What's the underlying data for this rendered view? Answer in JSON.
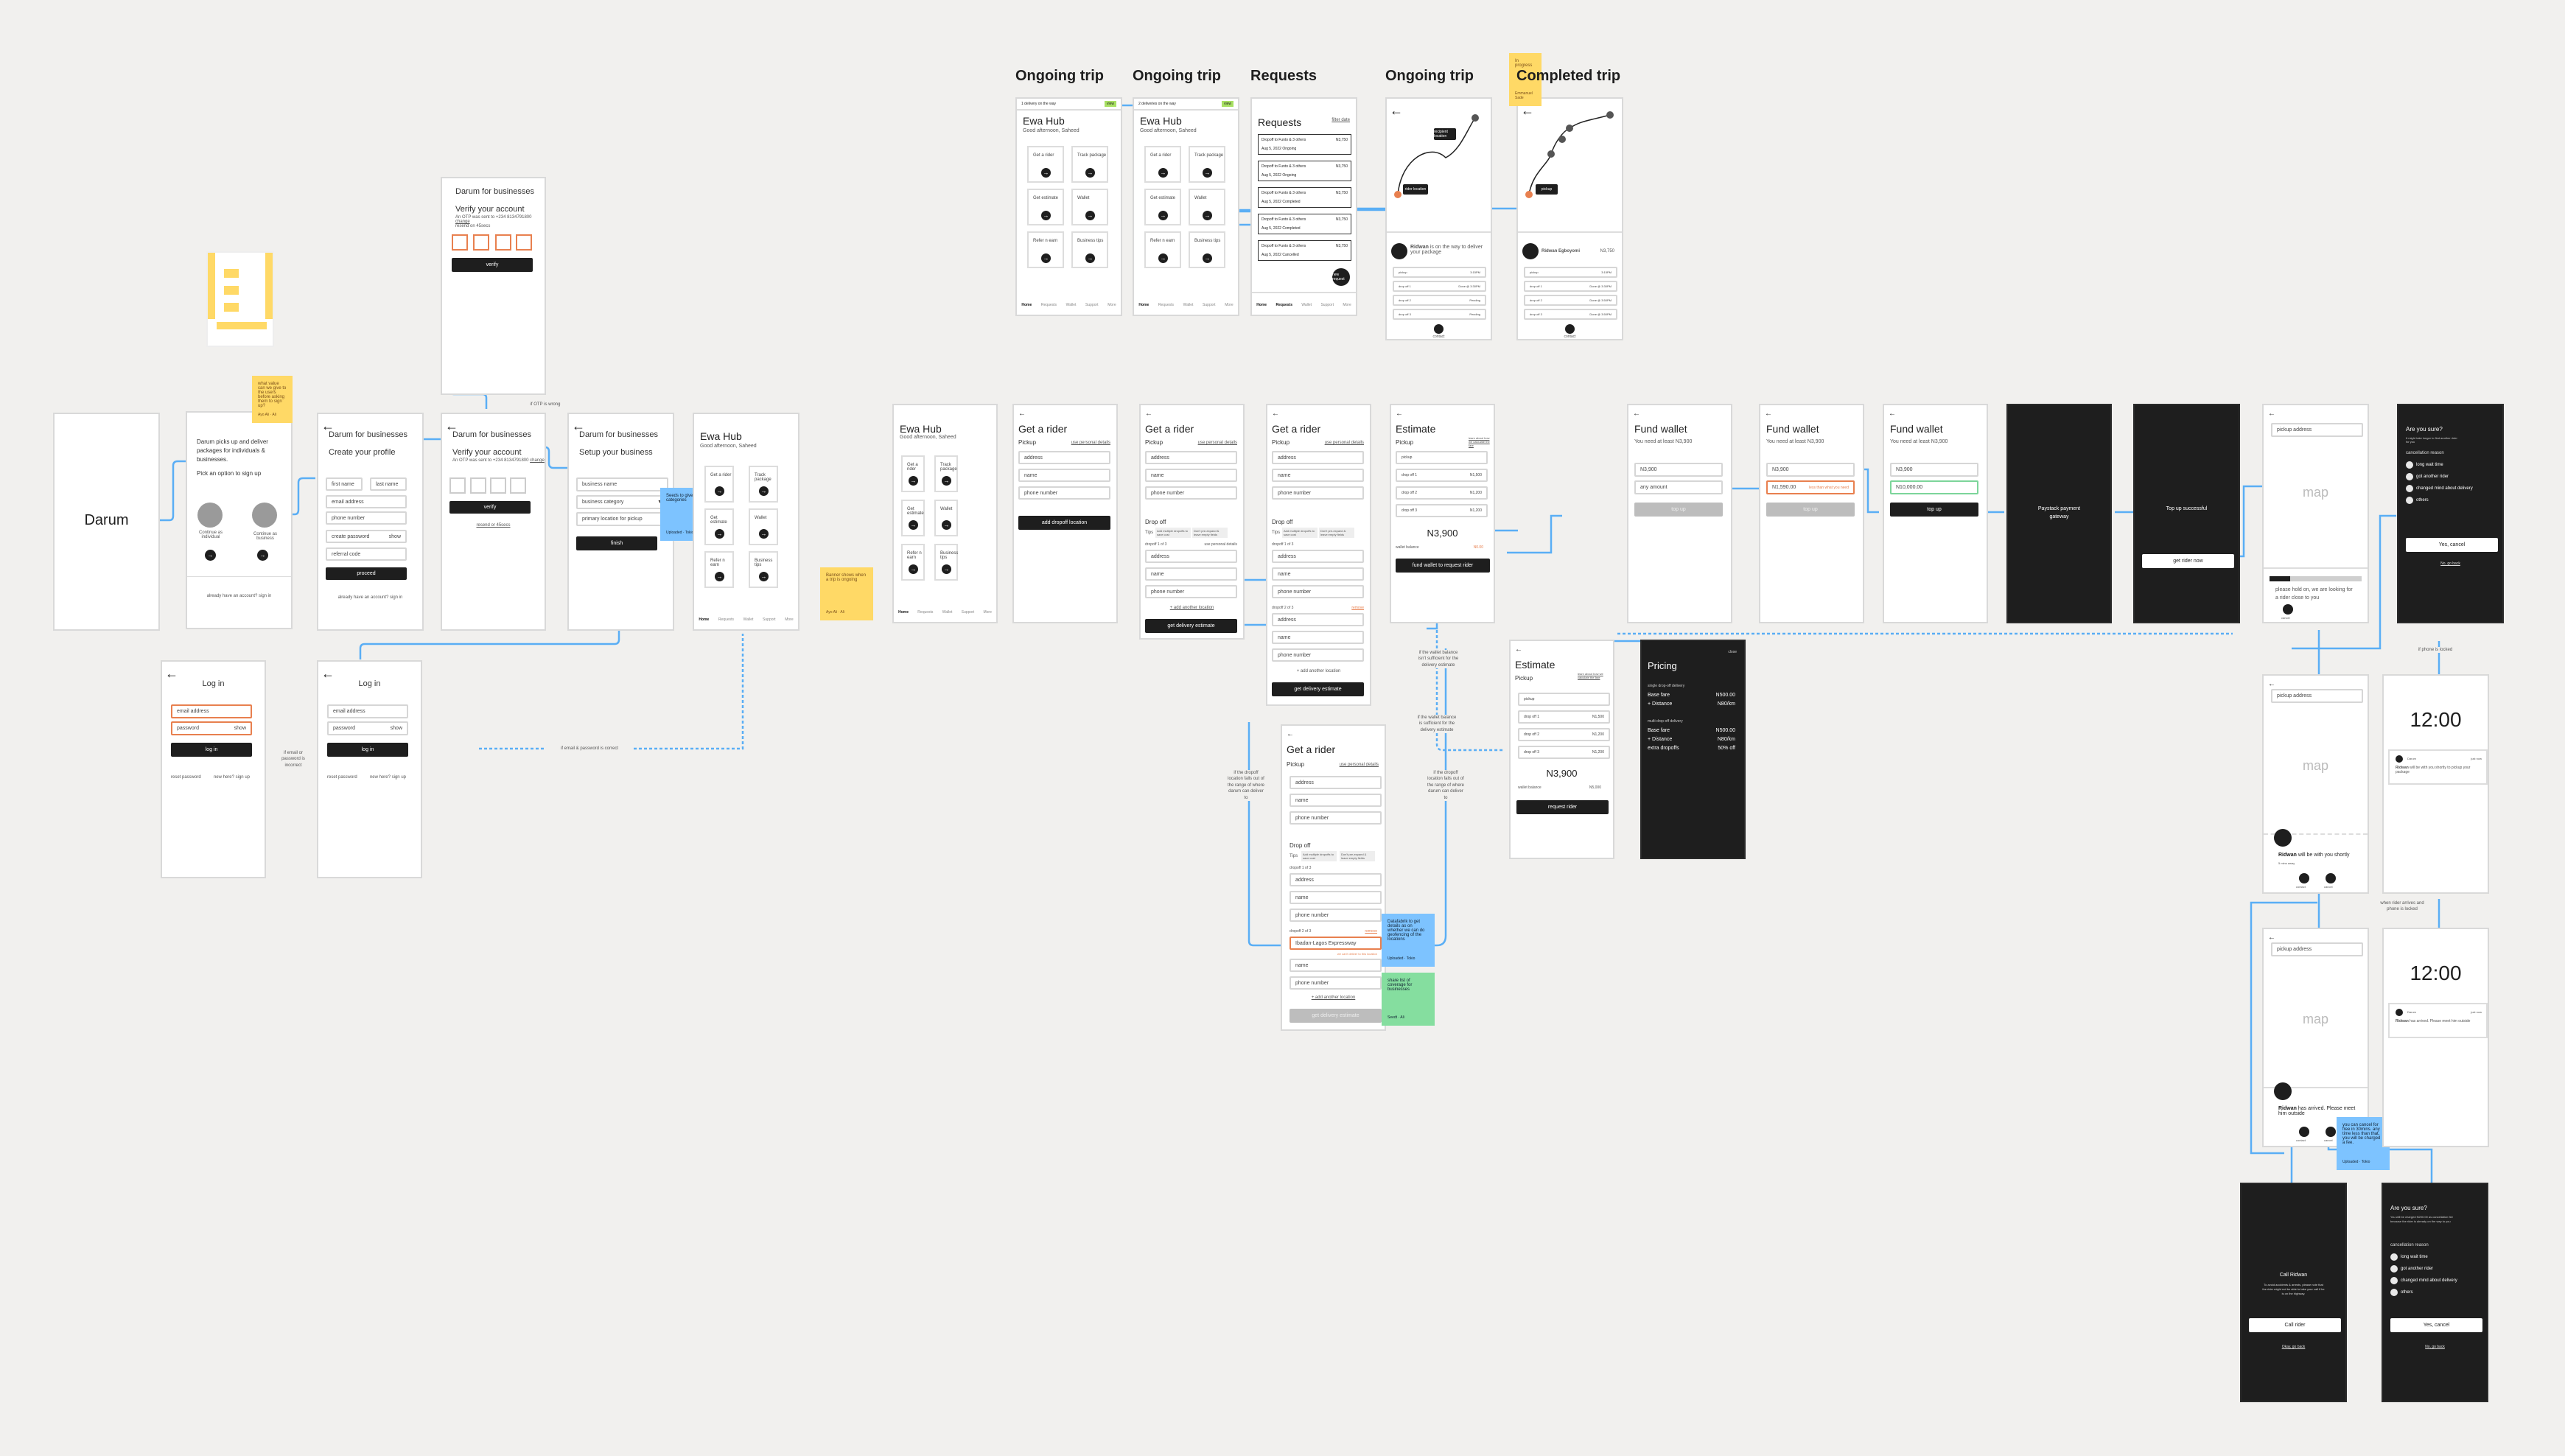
{
  "canvas": {
    "background": "#f1f0ee",
    "accent_wire": "#5aaef5",
    "error": "#e8804f",
    "success": "#7cd59a"
  },
  "sections": {
    "ongoing_trip_1": "Ongoing trip",
    "ongoing_trip_2": "Ongoing trip",
    "requests": "Requests",
    "ongoing_trip_3": "Ongoing trip",
    "completed_trip": "Completed trip"
  },
  "splash": {
    "title": "Darum"
  },
  "onboard": {
    "intro": "Darum picks up and deliver packages for individuals & businesses.",
    "pick": "Pick an option to sign up",
    "individual": "Continue as individual",
    "business": "Continue as business",
    "signin": "already have an account? sign in"
  },
  "profile": {
    "brand": "Darum for businesses",
    "title": "Create your profile",
    "first_name": "first name",
    "last_name": "last name",
    "email": "email address",
    "phone": "phone number",
    "password": "create password",
    "show": "show",
    "referral": "referral code",
    "proceed": "proceed",
    "signin": "already have an account? sign in"
  },
  "verify": {
    "brand": "Darum for businesses",
    "title": "Verify your account",
    "otp_sent": "An OTP was sent to +234 8134791800",
    "change": "change",
    "resend_hint": "resend on 45secs",
    "verify": "verify",
    "resend": "resend or 45secs"
  },
  "setup": {
    "brand": "Darum for businesses",
    "title": "Setup your business",
    "name": "business name",
    "category": "business category",
    "location": "primary location for pickup",
    "finish": "finish"
  },
  "hub": {
    "title": "Ewa Hub",
    "greeting": "Good afternoon, Saheed",
    "tiles": [
      "Get a rider",
      "Track package",
      "Get estimate",
      "Wallet",
      "Refer n earn",
      "Business tips"
    ],
    "nav": [
      "Home",
      "Requests",
      "Wallet",
      "Support",
      "More"
    ],
    "banner_1": "1 delivery on the way",
    "banner_2": "2 deliveries on the way",
    "banner_view": "view"
  },
  "login": {
    "title": "Log in",
    "email": "email address",
    "password": "password",
    "show": "show",
    "login": "log in",
    "reset": "reset password",
    "signup": "new here? sign up"
  },
  "requests": {
    "title": "Requests",
    "filter": "filter date",
    "items": [
      {
        "title": "Dropoff to Funto & 3 others",
        "amount": "N3,750",
        "date": "Aug 5, 2022",
        "status": "Ongoing"
      },
      {
        "title": "Dropoff to Funto & 3 others",
        "amount": "N3,750",
        "date": "Aug 5, 2022",
        "status": "Ongoing"
      },
      {
        "title": "Dropoff to Funto & 3 others",
        "amount": "N3,750",
        "date": "Aug 5, 2022",
        "status": "Completed"
      },
      {
        "title": "Dropoff to Funto & 3 others",
        "amount": "N3,750",
        "date": "Aug 5, 2022",
        "status": "Completed"
      },
      {
        "title": "Dropoff to Funto & 3 others",
        "amount": "N3,750",
        "date": "Aug 5, 2022",
        "status": "Cancelled"
      }
    ],
    "fab": "new request",
    "nav": [
      "Home",
      "Requests",
      "Wallet",
      "Support",
      "More"
    ]
  },
  "trip_ongoing": {
    "rider_label": "rider location",
    "recipient_label": "recipient location",
    "rider_name": "Ridwan",
    "message": "is on the way to deliver your package",
    "stops": [
      {
        "label": "pickup",
        "value": "3:15PM"
      },
      {
        "label": "drop off 1",
        "value": "Done @ 3:30PM"
      },
      {
        "label": "drop off 2",
        "value": "Pending"
      },
      {
        "label": "drop off 3",
        "value": "Pending"
      }
    ],
    "contact": "contact"
  },
  "trip_completed": {
    "pin_label": "pickup",
    "rider_name": "Ridwan Egboyomi",
    "amount": "N3,750",
    "stops": [
      {
        "label": "pickup",
        "value": "3:15PM"
      },
      {
        "label": "drop off 1",
        "value": "Done @ 3:30PM"
      },
      {
        "label": "drop off 2",
        "value": "Done @ 3:50PM"
      },
      {
        "label": "drop off 3",
        "value": "Done @ 3:50PM"
      }
    ],
    "contact": "contact"
  },
  "get_rider": {
    "title": "Get a rider",
    "pickup": "Pickup",
    "use_personal": "use personal details",
    "address": "address",
    "name": "name",
    "phone": "phone number",
    "add_dropoff": "add dropoff location",
    "dropoff": "Drop off",
    "tips": "Tips",
    "tip_1": "Add multiple dropoffs to save cost",
    "tip_2": "Don't pre-expand & leave empty fields",
    "dropoff_1": "dropoff 1 of 3",
    "dropoff_2": "dropoff 2 of 3",
    "remove": "remove",
    "add_location": "+ add another location",
    "get_estimate": "get delivery estimate",
    "out_of_range_value": "Ibadan-Lagos Expressway",
    "out_of_range_msg": "we can't deliver to this location"
  },
  "estimate": {
    "title": "Estimate",
    "pickup": "Pickup",
    "learn": "learn about how we calculate the fare",
    "rows": [
      {
        "label": "pickup",
        "value": ""
      },
      {
        "label": "drop off 1",
        "value": "N1,500"
      },
      {
        "label": "drop off 2",
        "value": "N1,200"
      },
      {
        "label": "drop off 3",
        "value": "N1,200"
      }
    ],
    "total": "N3,900",
    "wallet_label": "wallet balance",
    "wallet_low": "N0.00",
    "wallet_ok": "N5,000",
    "fund_btn": "fund wallet to request rider",
    "request_btn": "request rider"
  },
  "pricing": {
    "close": "close",
    "title": "Pricing",
    "single": "single drop-off delivery",
    "multi": "multi drop-off delivery",
    "single_rows": [
      {
        "label": "Base fare",
        "value": "N500.00"
      },
      {
        "label": "+ Distance",
        "value": "N80/km"
      }
    ],
    "multi_rows": [
      {
        "label": "Base fare",
        "value": "N500.00"
      },
      {
        "label": "+ Distance",
        "value": "N80/km"
      },
      {
        "label": "extra dropoffs",
        "value": "50% off"
      }
    ]
  },
  "fund": {
    "title": "Fund wallet",
    "need": "You need at least N3,900",
    "suggested": "N3,900",
    "placeholder": "any amount",
    "low_value": "N1,590.00",
    "low_msg": "less than what you need",
    "ok_value": "N10,000.00",
    "topup": "top up"
  },
  "paystack": {
    "label": "Paystack payment gateway"
  },
  "topup_success": {
    "label": "Top up successful",
    "button": "get rider now"
  },
  "searching": {
    "address": "pickup address",
    "map": "map",
    "message": "please hold on, we are looking for a rider close to you",
    "cancel": "cancel",
    "progress": 0.22
  },
  "cancel_1": {
    "title": "Are you sure?",
    "sub": "It might take longer to find another rider for you",
    "reason": "cancellation reason",
    "options": [
      "long wait time",
      "got another rider",
      "changed mind about delivery",
      "others"
    ],
    "yes": "Yes, cancel",
    "no": "No, go back"
  },
  "rider_found": {
    "address": "pickup address",
    "map": "map",
    "name": "Ridwan",
    "message": "will be with you shortly",
    "eta": "5 mins away",
    "contact": "contact",
    "cancel": "cancel"
  },
  "rider_arrived": {
    "address": "pickup address",
    "map": "map",
    "name": "Ridwan",
    "message": "has arrived. Please meet him outside",
    "contact": "contact",
    "cancel": "cancel"
  },
  "lock_1": {
    "time": "12:00",
    "app": "Darum",
    "when": "just now",
    "name": "Ridwan",
    "message": "will be with you shortly to pickup your package"
  },
  "lock_2": {
    "time": "12:00",
    "app": "Darum",
    "when": "just now",
    "name": "Ridwan",
    "message": "has arrived. Please meet him outside"
  },
  "call": {
    "title": "Call Ridwan",
    "body": "To avoid accidents & arrests, please note that the rider might not be able to take your call if he is on the highway.",
    "call_btn": "Call rider",
    "back": "Okay, go back"
  },
  "cancel_2": {
    "title": "Are you sure?",
    "sub": "You will be charged N200.00 as cancellation fee because the rider is already on the way to you",
    "reason": "cancellation reason",
    "options": [
      "long wait time",
      "got another rider",
      "changed mind about delivery",
      "others"
    ],
    "yes": "Yes, cancel",
    "no": "No, go back"
  },
  "notes": {
    "otp_expiry": "if OTP is wrong",
    "login_fail": "if email or password is incorrect",
    "login_ok": "if email & password is correct",
    "wallet_low": "if the wallet balance isn't sufficient for the delivery estimate",
    "wallet_ok": "if the wallet balance is sufficient for the delivery estimate",
    "range_left": "if the dropoff location falls out of the range of where darum can deliver to",
    "range_right": "if the dropoff location falls out of the range of where darum can deliver to",
    "rider_arrives": "when rider arrives and phone is locked",
    "phone_locked": "if phone is locked"
  },
  "stickies": {
    "value_prop": {
      "text": "what value can we give to the users before asking them to sign up?",
      "author": "Ayo Ali · Ali"
    },
    "categories": {
      "text": "Seeds to give categories",
      "author": "Uploaded · Tokio"
    },
    "banner": {
      "text": "Banner shows when a trip is ongoing",
      "author": "Ayo Ali · Ali"
    },
    "in_progress": {
      "text": "In progress",
      "author": "Emmanuel Sade"
    },
    "geofence": {
      "text": "Datafabrik to get details as on whether we can do geofencing of the locations",
      "author": "Uploaded · Tokio"
    },
    "coverage": {
      "text": "share list of coverage for businesses",
      "author": "Seedt · Ali"
    },
    "cancel_fee": {
      "text": "you can cancel for free in 30mins. any time less than that, you will be charged a fee.",
      "author": "Uploaded · Tokio"
    }
  }
}
